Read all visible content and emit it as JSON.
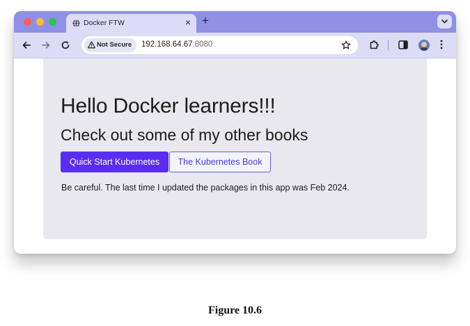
{
  "browser": {
    "tab": {
      "title": "Docker FTW",
      "close_glyph": "×",
      "favicon": "globe-icon"
    },
    "new_tab_glyph": "+",
    "address_bar": {
      "security_label": "Not Secure",
      "url_host": "192.168.64.67",
      "url_port": ":8080"
    },
    "toolbar_icons": [
      "back-arrow-icon",
      "forward-arrow-icon",
      "reload-icon",
      "warning-icon",
      "star-icon",
      "extensions-puzzle-icon",
      "side-panel-icon",
      "profile-avatar",
      "more-menu-icon"
    ],
    "colors": {
      "titlebar": "#8f8fe6",
      "toolbar": "#dcdcf6"
    }
  },
  "page": {
    "heading": "Hello Docker learners!!!",
    "subheading": "Check out some of my other books",
    "buttons": {
      "primary_label": "Quick Start Kubernetes",
      "secondary_label": "The Kubernetes Book"
    },
    "note": "Be careful. The last time I updated the packages in this app was Feb 2024.",
    "colors": {
      "panel_bg": "#e8e8ee",
      "primary_button": "#5a2df2",
      "secondary_button_border": "#6a5fe0"
    }
  },
  "caption": "Figure 10.6"
}
